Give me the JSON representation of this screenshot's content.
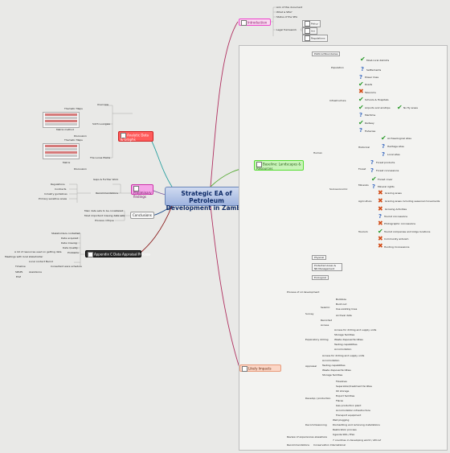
{
  "central": {
    "title": "Strategic EA of Petroleum Development in Zambia"
  },
  "topics": {
    "introduction": "Introduction",
    "baseline": "Baseline: Landscapes & Resources",
    "likely_impacts": "Likely Impacts",
    "analytic": "Analytic Data & Graphs",
    "preliminary": "Preliminary findings",
    "conclusions": "Conclusions",
    "appendix": "Appendix C Data Appraisal Process"
  },
  "intro": {
    "items": [
      "Aim of this document",
      "What is SEA?",
      "Status of the SEA"
    ],
    "legal": "Legal framework",
    "legal_items": [
      "Policy",
      "Act",
      "Regulations"
    ]
  },
  "baseline": {
    "political": "Political Boundaries",
    "human": "Human",
    "population": "Population",
    "pop_items": [
      "Most-rural districts",
      "Settlements"
    ],
    "infrastructure": "Infrastructure",
    "infra_items": [
      "Power lines",
      "Roads",
      "Telecoms",
      "Schools & Hospitals",
      "Airports and airstrips",
      "Maritime",
      "Railway",
      "Fisheries"
    ],
    "no_fly": "No fly areas",
    "socioeconomic": "Socioeconomic",
    "historical": "Historical",
    "hist_items": [
      "Archaeological sites",
      "Heritage sites",
      "Local sites"
    ],
    "forest": "Forest",
    "forest_items": [
      "Forest products",
      "Forest concessions"
    ],
    "minerals": "Minerals",
    "mineral_items": [
      "Forest cover",
      "Mineral rights"
    ],
    "agriculture": "Agriculture",
    "agri_items": [
      "Grazing areas",
      "Grazing areas including seasonal movements",
      "Growing Activities"
    ],
    "tourism": "Tourism",
    "tour_items": [
      "Tourist concessions",
      "Photographic concessions",
      "Tourist companies and lodge locations",
      "Community arduism",
      "Hunting Concessions"
    ],
    "physical": "Physical",
    "protected": "Protected Areas & NR Management",
    "ecological": "Ecological"
  },
  "impacts": {
    "process": "Process of oil development",
    "survey": "Survey",
    "seismic": "Seismic",
    "seismic_items": [
      "Bulldoze",
      "Build out",
      "Use existing lines",
      "Archival data"
    ],
    "recorded": "Recorded",
    "access": "Access",
    "expl": "Exploratory drilling",
    "expl_items": [
      "Access for drilling and supply units",
      "Storage facilities",
      "Waste disposal facilities",
      "Testing capabilities",
      "Accomodation"
    ],
    "appraisal": "Appraisal",
    "appr_items": [
      "Access for drilling and supply units",
      "Accomodation",
      "Testing capabilities",
      "Waste disposal facilities",
      "Storage facilities"
    ],
    "develop": "Develop / production",
    "dev_items": [
      "Flowlines",
      "Separation/treatment facilites",
      "Oil storage",
      "Export facilities",
      "Flares",
      "Gas production plant",
      "Accomodation infrastructure",
      "Transport equipment"
    ],
    "decom": "Decommissioning",
    "decom_items": [
      "Well plugging",
      "Dismantling and removing installations",
      "Restoration process"
    ],
    "review": "Review of experiences elsewhere",
    "review_items": [
      "Uganda SEA / ESA",
      "7 countries in developing world / Africa?"
    ],
    "recs": "Recommendations",
    "ci": "Conservation International"
  },
  "analytic": {
    "thematic1": "Thematic Maps",
    "overview": "Overview",
    "matrix_method": "Matrix method",
    "discussion1": "Discussion",
    "thematic2": "Thematic Maps",
    "sixth": "Sixth Luangwa",
    "matrix": "Matrix",
    "discussion2": "Discussion",
    "lunsa": "The Lunsa Plains"
  },
  "prelim": {
    "gaps": "Gaps & Further Work",
    "items": [
      "Regulations",
      "Contracts",
      "Industry guidelines",
      "Primary sensitive areas"
    ],
    "recs": "Recommendations"
  },
  "conclusions": {
    "items": [
      "Main data sets to be considered",
      "Most important missing data sets",
      "Process critique"
    ]
  },
  "appendix": {
    "items": [
      "Stakeholders contacted",
      "Data acquired",
      "Data missing",
      "Data Quality",
      "Problems"
    ],
    "problems": [
      "A lot of resources used on getting data",
      "Meetings with local stakeholder",
      "Local contact Bernd"
    ],
    "consultant": "Consultant were schedule",
    "consultant_items": [
      "Timeline",
      "SPAPS",
      "Assistance",
      "ECZ"
    ]
  },
  "colors": {
    "intro": "#ee44cc",
    "baseline": "#55dd33",
    "impacts": "#f7b39a",
    "analytic": "#ee3333",
    "preliminary": "#ee33cc",
    "appendix": "#222222"
  }
}
